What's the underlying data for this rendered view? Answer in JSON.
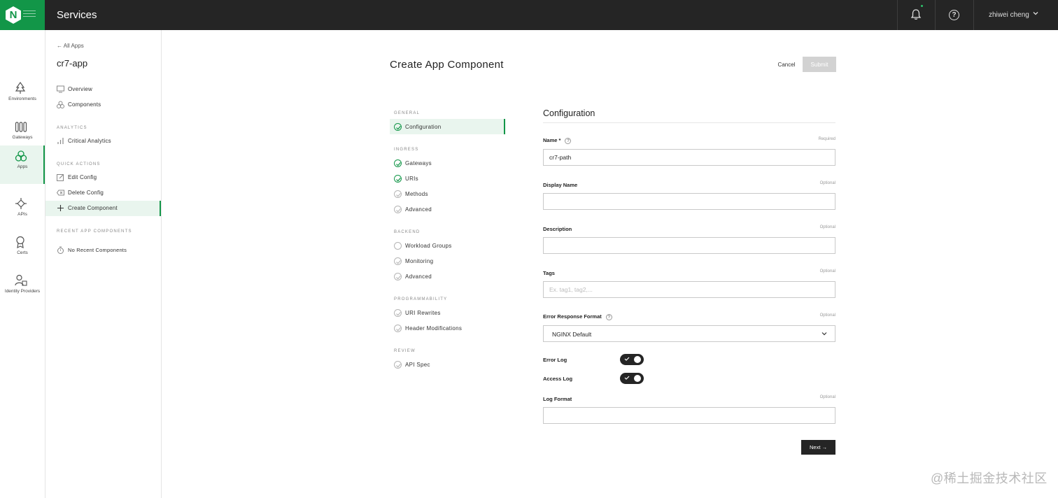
{
  "topbar": {
    "section_title": "Services",
    "user_name": "zhiwei cheng"
  },
  "rail": {
    "items": [
      {
        "label": "Environments"
      },
      {
        "label": "Gateways"
      },
      {
        "label": "Apps"
      },
      {
        "label": "APIs"
      },
      {
        "label": "Certs"
      },
      {
        "label": "Identity Providers"
      }
    ]
  },
  "sidebar": {
    "back_label": "All Apps",
    "app_name": "cr7-app",
    "nav": [
      {
        "label": "Overview"
      },
      {
        "label": "Components"
      }
    ],
    "analytics_heading": "ANALYTICS",
    "analytics": [
      {
        "label": "Critical Analytics"
      }
    ],
    "quick_actions_heading": "QUICK ACTIONS",
    "quick_actions": [
      {
        "label": "Edit Config"
      },
      {
        "label": "Delete Config"
      },
      {
        "label": "Create Component"
      }
    ],
    "recent_heading": "RECENT APP COMPONENTS",
    "recent_empty": "No Recent Components"
  },
  "main": {
    "title": "Create App Component",
    "cancel_label": "Cancel",
    "submit_label": "Submit"
  },
  "steps": {
    "groups": [
      {
        "heading": "GENERAL",
        "items": [
          {
            "label": "Configuration"
          }
        ]
      },
      {
        "heading": "INGRESS",
        "items": [
          {
            "label": "Gateways"
          },
          {
            "label": "URIs"
          },
          {
            "label": "Methods"
          },
          {
            "label": "Advanced"
          }
        ]
      },
      {
        "heading": "BACKEND",
        "items": [
          {
            "label": "Workload Groups"
          },
          {
            "label": "Monitoring"
          },
          {
            "label": "Advanced"
          }
        ]
      },
      {
        "heading": "PROGRAMMABILITY",
        "items": [
          {
            "label": "URI Rewrites"
          },
          {
            "label": "Header Modifications"
          }
        ]
      },
      {
        "heading": "REVIEW",
        "items": [
          {
            "label": "API Spec"
          }
        ]
      }
    ]
  },
  "form": {
    "section_title": "Configuration",
    "name": {
      "label": "Name *",
      "note": "Required",
      "value": "cr7-path"
    },
    "display_name": {
      "label": "Display Name",
      "note": "Optional",
      "value": ""
    },
    "description": {
      "label": "Description",
      "note": "Optional",
      "value": ""
    },
    "tags": {
      "label": "Tags",
      "note": "Optional",
      "placeholder": "Ex. tag1, tag2,..."
    },
    "error_response_format": {
      "label": "Error Response Format",
      "note": "Optional",
      "selected": "NGINX Default"
    },
    "error_log": {
      "label": "Error Log",
      "enabled": true
    },
    "access_log": {
      "label": "Access Log",
      "enabled": true
    },
    "log_format": {
      "label": "Log Format",
      "note": "Optional",
      "value": ""
    },
    "next_label": "Next →"
  },
  "watermark": "@稀土掘金技术社区",
  "colors": {
    "brand_green": "#129648",
    "topbar_bg": "#252525",
    "active_bg": "#e9f5ee"
  }
}
